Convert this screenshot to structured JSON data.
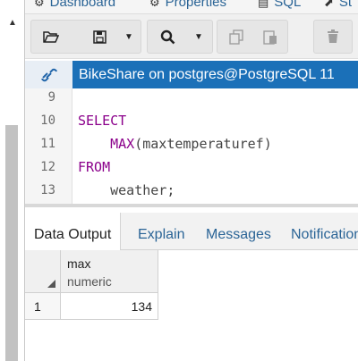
{
  "top_tabs": [
    {
      "label": "Dashboard",
      "icon": "dashboard-icon"
    },
    {
      "label": "Properties",
      "icon": "properties-icon"
    },
    {
      "label": "SQL",
      "icon": "sql-icon"
    },
    {
      "label": "St",
      "icon": "statistics-icon"
    }
  ],
  "toolbar": {
    "open": "open-file-icon",
    "save": "save-icon",
    "find": "find-icon",
    "copy": "copy-icon",
    "paste": "paste-icon",
    "delete": "delete-icon"
  },
  "connection": {
    "label": "BikeShare on postgres@PostgreSQL 11",
    "icon": "connection-icon"
  },
  "editor": {
    "lines": [
      {
        "num": "9",
        "tokens": []
      },
      {
        "num": "10",
        "keyword": "SELECT"
      },
      {
        "num": "11",
        "indent": "    ",
        "func": "MAX",
        "arg": "(maxtemperaturef)"
      },
      {
        "num": "12",
        "keyword": "FROM"
      },
      {
        "num": "13",
        "indent": "    ",
        "text": "weather;"
      }
    ]
  },
  "result_tabs": [
    "Data Output",
    "Explain",
    "Messages",
    "Notifications"
  ],
  "grid": {
    "columns": [
      {
        "name": "max",
        "type": "numeric"
      }
    ],
    "rows": [
      {
        "num": "1",
        "values": [
          "134"
        ]
      }
    ]
  },
  "colors": {
    "accent": "#1b70b8",
    "keyword": "#8b008b",
    "link": "#2a6496"
  }
}
